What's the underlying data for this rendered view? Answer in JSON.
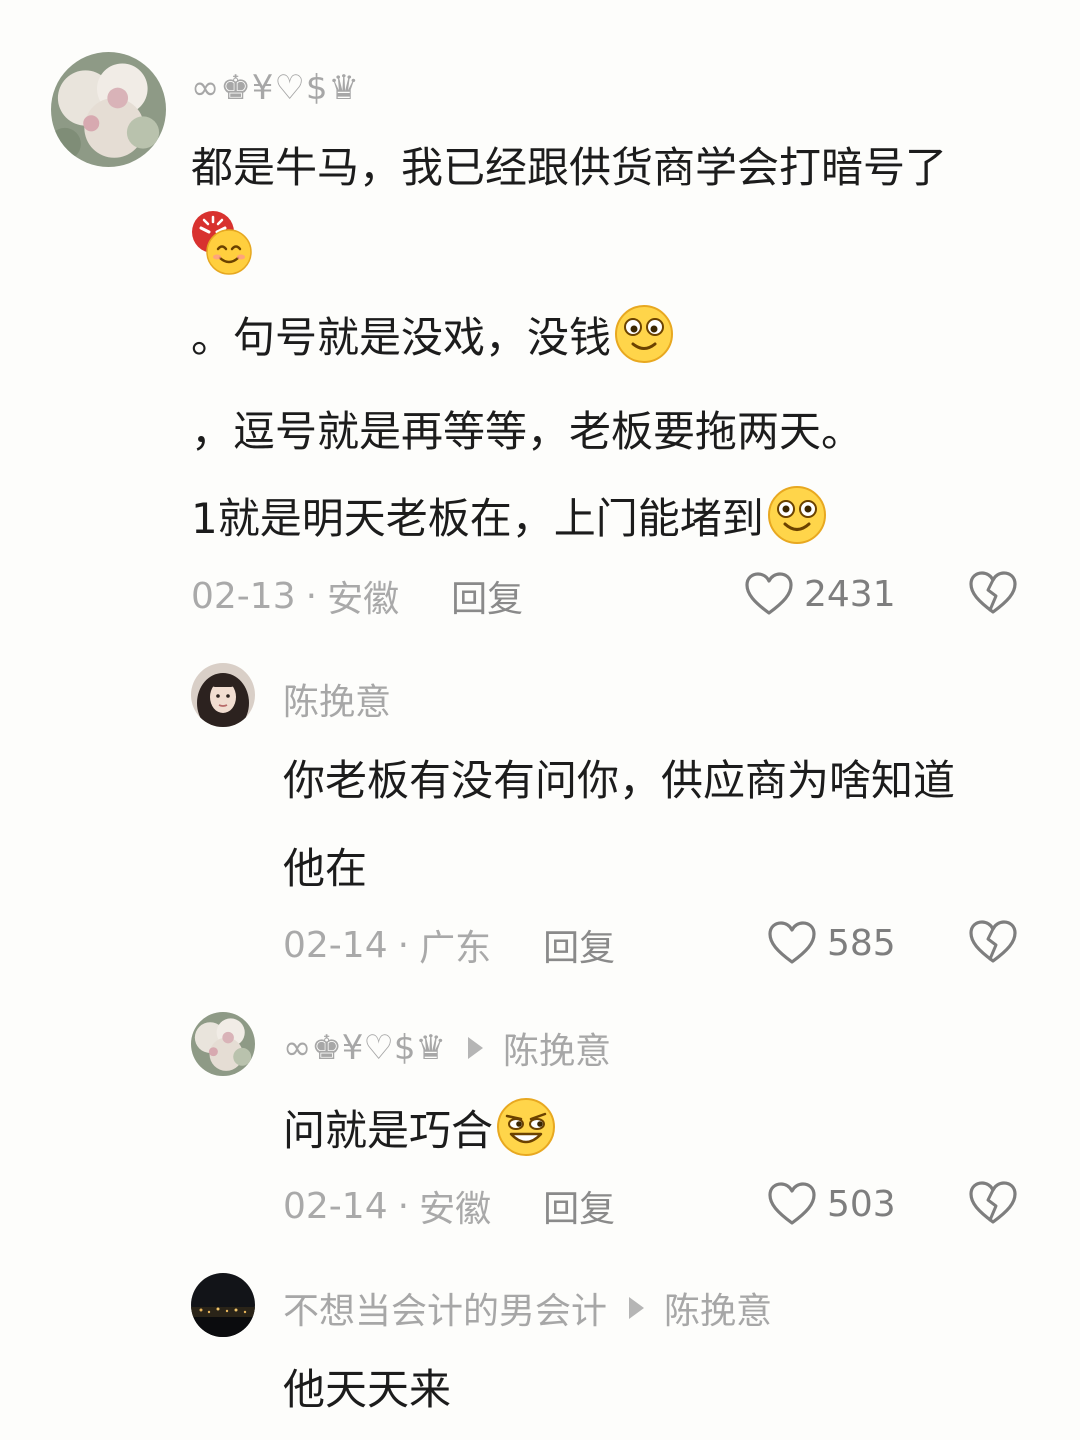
{
  "comments": [
    {
      "username": "∞♚¥♡$♛",
      "lines": [
        "都是牛马，我已经跟供货商学会打暗号了",
        "。句号就是没戏，没钱",
        "，逗号就是再等等，老板要拖两天。",
        "1就是明天老板在，上门能堵到"
      ],
      "date": "02-13",
      "region": "安徽",
      "reply_label": "回复",
      "likes": "2431"
    },
    {
      "username": "陈挽意",
      "lines": [
        "你老板有没有问你，供应商为啥知道",
        "他在"
      ],
      "date": "02-14",
      "region": "广东",
      "reply_label": "回复",
      "likes": "585"
    },
    {
      "username": "∞♚¥♡$♛",
      "reply_to": "陈挽意",
      "lines": [
        "问就是巧合"
      ],
      "date": "02-14",
      "region": "安徽",
      "reply_label": "回复",
      "likes": "503"
    },
    {
      "username": "不想当会计的男会计",
      "reply_to": "陈挽意",
      "lines": [
        "他天天来"
      ]
    }
  ],
  "emojis": {
    "c0_after_line0": "angry-smile-emoji",
    "c0_line1": "shy-smile-emoji",
    "c0_line3": "smile-emoji",
    "c2_line0": "sly-smile-emoji"
  },
  "colors": {
    "background": "#fdfdfb",
    "text": "#1c1c1c",
    "muted": "#a9a9a9",
    "icon": "#7e7e7e"
  }
}
